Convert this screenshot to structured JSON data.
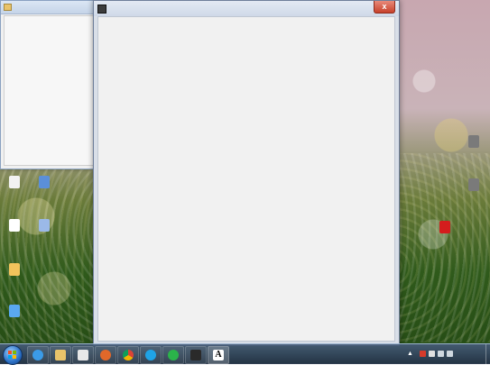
{
  "left_window": {
    "title": "",
    "icon": "folder-icon"
  },
  "main_window": {
    "title": "",
    "icon": "terminal-app-icon",
    "close_label": "x"
  },
  "desktop_icons": [
    {
      "label": "",
      "icon": "document-icon",
      "color": "#f2f2f2"
    },
    {
      "label": "",
      "icon": "computer-icon",
      "color": "#5b8fd8"
    },
    {
      "label": "",
      "icon": "file-icon",
      "color": "#ffffff"
    },
    {
      "label": "",
      "icon": "shortcut-icon",
      "color": "#9bb9e8"
    },
    {
      "label": "",
      "icon": "folder-icon",
      "color": "#f2c35c"
    },
    {
      "label": "",
      "icon": "settings-icon",
      "color": "#5aa8f0"
    },
    {
      "label": "",
      "icon": "app-icon",
      "color": "#7a7a7a"
    },
    {
      "label": "",
      "icon": "app-icon",
      "color": "#7a7a7a"
    },
    {
      "label": "",
      "icon": "red-app-icon",
      "color": "#d41d1d"
    }
  ],
  "taskbar": {
    "items": [
      {
        "icon": "internet-explorer-icon",
        "color": "#3b9be8"
      },
      {
        "icon": "file-explorer-icon",
        "color": "#e9c36a"
      },
      {
        "icon": "media-player-icon",
        "color": "#e8e8e8"
      },
      {
        "icon": "firefox-icon",
        "color": "#e0682a"
      },
      {
        "icon": "chrome-icon",
        "color": "#4caf50"
      },
      {
        "icon": "skype-icon",
        "color": "#1fa3e6"
      },
      {
        "icon": "green-app-icon",
        "color": "#2bb34a"
      },
      {
        "icon": "terminal-icon",
        "color": "#2a2a2a"
      },
      {
        "icon": "font-icon",
        "letter": "A"
      }
    ],
    "clock": {
      "time": "",
      "date": ""
    }
  }
}
